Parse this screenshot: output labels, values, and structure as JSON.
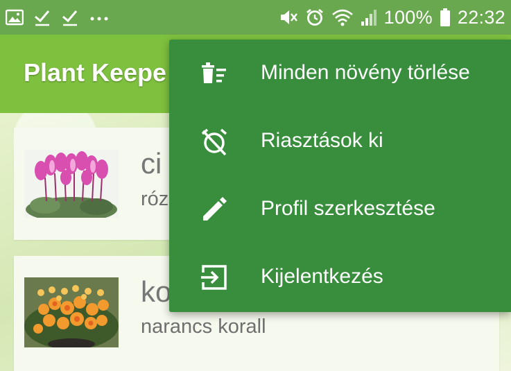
{
  "status_bar": {
    "battery_percent": "100%",
    "time": "22:32",
    "left_icons": [
      "gallery-icon",
      "check-icon",
      "check-icon",
      "more-dots-icon"
    ],
    "right_icons": [
      "mute-icon",
      "alarm-icon",
      "wifi-icon",
      "signal-icon",
      "battery-icon"
    ]
  },
  "app_bar": {
    "title": "Plant Keepe"
  },
  "plants": [
    {
      "name": "ci",
      "subtitle": "róz"
    },
    {
      "name": "ko",
      "subtitle": "narancs korall"
    }
  ],
  "overflow_menu": {
    "items": [
      {
        "label": "Minden növény törlése",
        "icon": "delete-sweep-icon"
      },
      {
        "label": "Riasztások ki",
        "icon": "alarm-off-icon"
      },
      {
        "label": "Profil szerkesztése",
        "icon": "edit-pencil-icon"
      },
      {
        "label": "Kijelentkezés",
        "icon": "logout-icon"
      }
    ]
  },
  "colors": {
    "status_bar": "#6aa84f",
    "app_bar": "#7ec13e",
    "menu": "#388e3c"
  }
}
